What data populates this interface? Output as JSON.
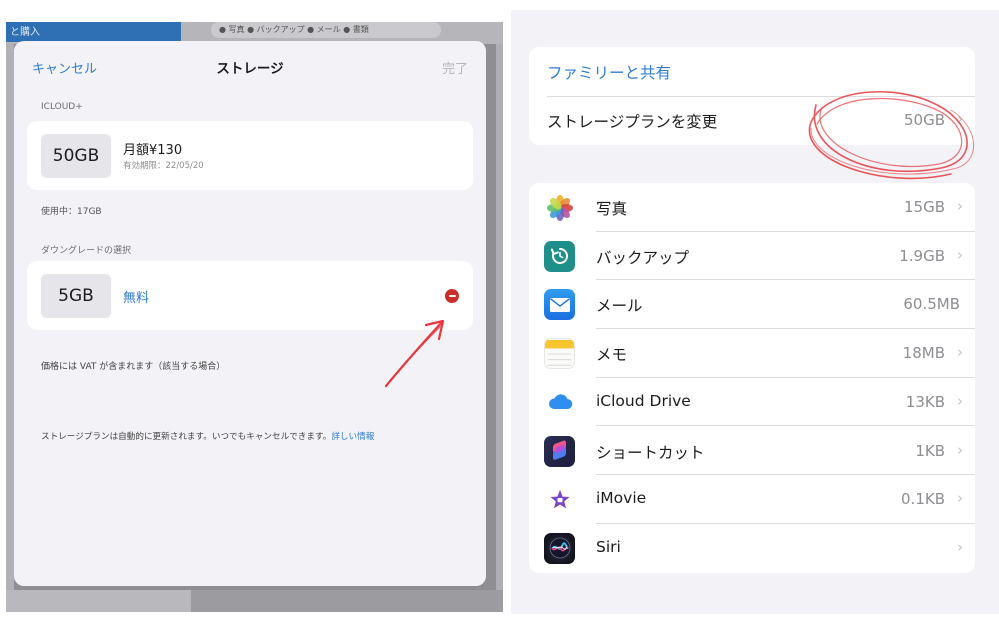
{
  "left_panel": {
    "background": {
      "top_left_text": "と購入",
      "legend_text": "● 写真  ● バックアップ  ● メール  ● 書類"
    },
    "modal": {
      "cancel_label": "キャンセル",
      "title": "ストレージ",
      "done_label": "完了",
      "section_current": "ICLOUD+",
      "current_plan": {
        "size": "50GB",
        "price": "月額¥130",
        "expiry": "有効期限：22/05/20"
      },
      "in_use": "使用中：17GB",
      "section_downgrade": "ダウングレードの選択",
      "downgrade_option": {
        "size": "5GB",
        "price": "無料"
      },
      "vat_note": "価格には VAT が含まれます（該当する場合）",
      "auto_renew_note": "ストレージプランは自動的に更新されます。いつでもキャンセルできます。",
      "learn_more_link": "詳しい情報"
    }
  },
  "right_panel": {
    "family_sharing_label": "ファミリーと共有",
    "change_plan": {
      "label": "ストレージプランを変更",
      "value": "50GB"
    },
    "apps": [
      {
        "name": "写真",
        "size": "15GB",
        "icon": "photos-icon",
        "chevron": true
      },
      {
        "name": "バックアップ",
        "size": "1.9GB",
        "icon": "backup-icon",
        "chevron": true
      },
      {
        "name": "メール",
        "size": "60.5MB",
        "icon": "mail-icon",
        "chevron": false
      },
      {
        "name": "メモ",
        "size": "18MB",
        "icon": "notes-icon",
        "chevron": true
      },
      {
        "name": "iCloud Drive",
        "size": "13KB",
        "icon": "icloud-drive-icon",
        "chevron": true
      },
      {
        "name": "ショートカット",
        "size": "1KB",
        "icon": "shortcuts-icon",
        "chevron": true
      },
      {
        "name": "iMovie",
        "size": "0.1KB",
        "icon": "imovie-icon",
        "chevron": true
      },
      {
        "name": "Siri",
        "size": "",
        "icon": "siri-icon",
        "chevron": true
      }
    ]
  },
  "colors": {
    "accent_blue": "#2f7bd6",
    "remove_red": "#c9302c",
    "annotation_red": "#e8383d",
    "background_gray": "#f2f2f7"
  }
}
